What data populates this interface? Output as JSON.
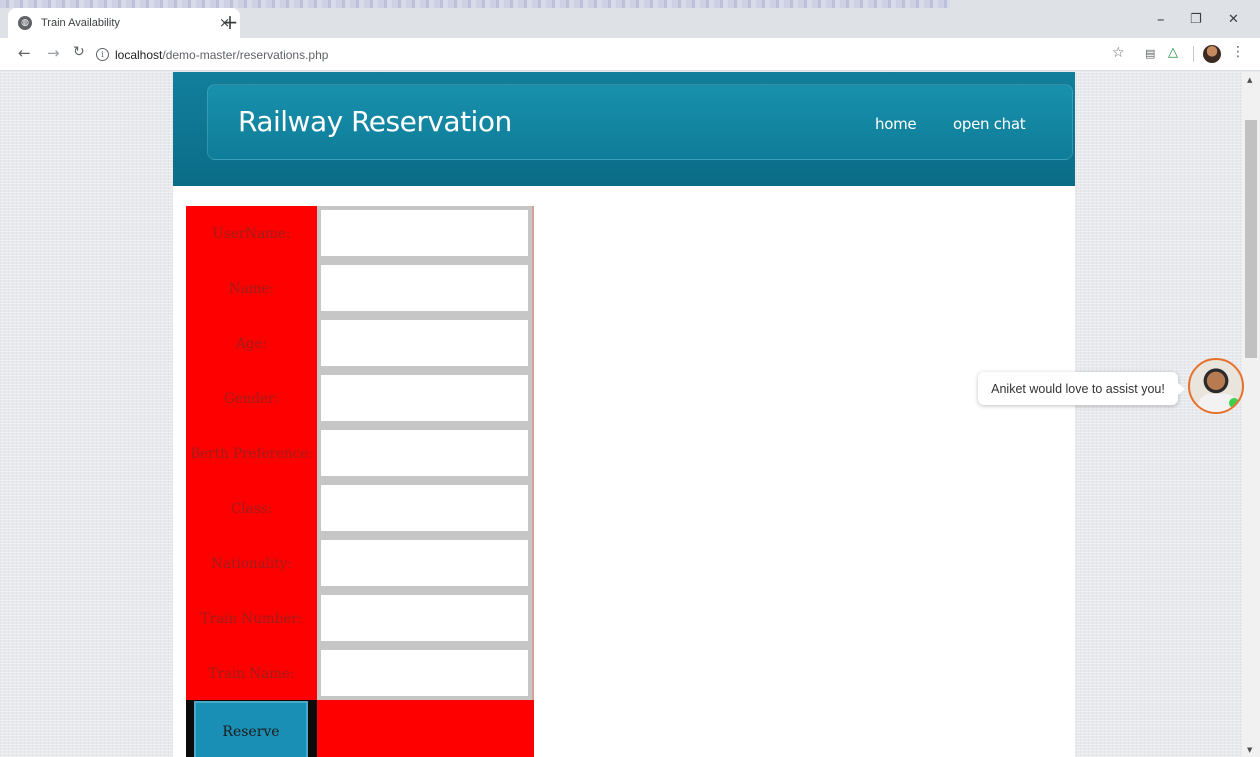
{
  "browser": {
    "tab_title": "Train Availability",
    "tab_close": "×",
    "new_tab": "+",
    "url_host": "localhost",
    "url_path": "/demo-master/reservations.php",
    "minimize": "–",
    "maximize": "❐",
    "close": "✕"
  },
  "header": {
    "brand": "Railway Reservation",
    "nav": [
      "home",
      "open chat"
    ]
  },
  "form": {
    "fields": [
      {
        "label": "UserName:",
        "value": ""
      },
      {
        "label": "Name:",
        "value": ""
      },
      {
        "label": "Age:",
        "value": ""
      },
      {
        "label": "Gender:",
        "value": ""
      },
      {
        "label": "Berth Preference:",
        "value": ""
      },
      {
        "label": "Class:",
        "value": ""
      },
      {
        "label": "Nationality:",
        "value": ""
      },
      {
        "label": "Train Number:",
        "value": ""
      },
      {
        "label": "Train Name:",
        "value": ""
      }
    ],
    "submit_label": "Reserve"
  },
  "chat": {
    "message": "Aniket would love to assist you!"
  },
  "colors": {
    "header_teal": "#0f7d99",
    "label_red": "#ff0000",
    "button_blue": "#1a8fb6"
  }
}
